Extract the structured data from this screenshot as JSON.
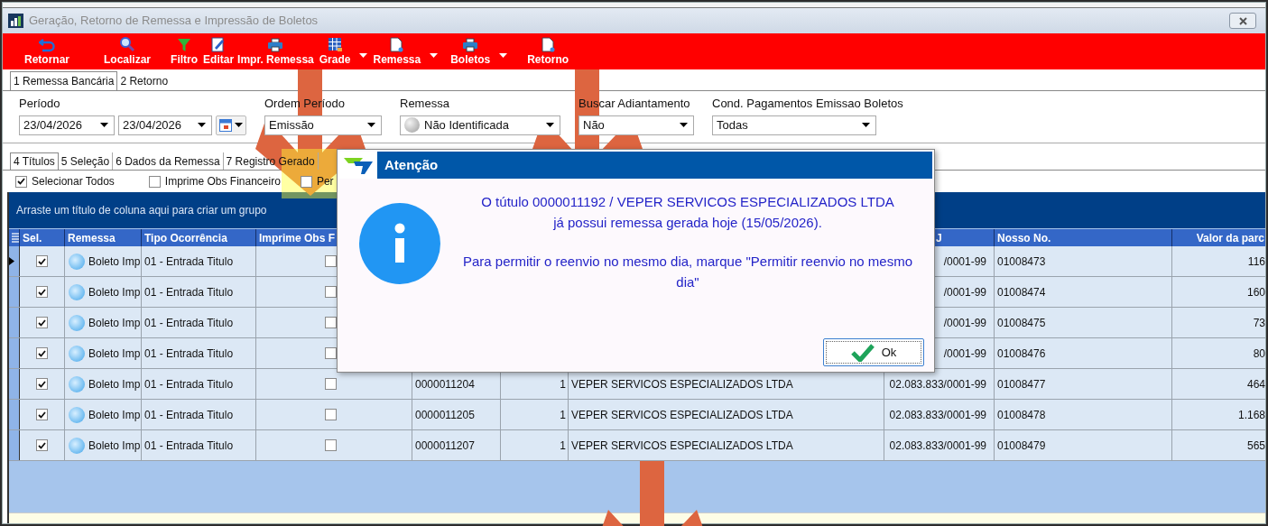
{
  "window": {
    "title": "Geração, Retorno de Remessa e Impressão de Boletos"
  },
  "toolbar": [
    {
      "label": "Retornar",
      "kind": "undo",
      "dropdown": false
    },
    {
      "label": "Localizar",
      "kind": "search",
      "dropdown": false
    },
    {
      "label": "Filtro",
      "kind": "filter",
      "dropdown": false
    },
    {
      "label": "Editar",
      "kind": "edit",
      "dropdown": false
    },
    {
      "label": "Impr. Remessa",
      "kind": "print",
      "dropdown": false
    },
    {
      "label": "Grade",
      "kind": "grid",
      "dropdown": true
    },
    {
      "label": "Remessa",
      "kind": "doc",
      "dropdown": true
    },
    {
      "label": "Boletos",
      "kind": "print",
      "dropdown": true
    },
    {
      "label": "Retorno",
      "kind": "doc",
      "dropdown": false
    }
  ],
  "main_tabs": [
    {
      "label": "1 Remessa Bancária",
      "selected": true
    },
    {
      "label": "2 Retorno",
      "selected": false
    }
  ],
  "filters": {
    "periodo": {
      "label": "Período",
      "from": "23/04/2026",
      "to": "23/04/2026"
    },
    "ordem": {
      "label": "Ordem Período",
      "value": "Emissão"
    },
    "remessa": {
      "label": "Remessa",
      "value": "Não Identificada"
    },
    "adiantamento": {
      "label": "Buscar Adiantamento",
      "value": "Não"
    },
    "cond": {
      "label": "Cond. Pagamentos Emissao Boletos",
      "value": "Todas"
    }
  },
  "sub_tabs": [
    {
      "label": "4 Títulos",
      "selected": true
    },
    {
      "label": "5 Seleção",
      "selected": false
    },
    {
      "label": "6 Dados da Remessa",
      "selected": false
    },
    {
      "label": "7 Registro Gerado",
      "selected": false
    }
  ],
  "options": [
    {
      "label": "Selecionar Todos",
      "checked": true
    },
    {
      "label": "Imprime Obs Financeiro",
      "checked": false
    },
    {
      "label": "Per",
      "checked": false
    }
  ],
  "grid": {
    "group_hint": "Arraste um título de coluna aqui para criar um grupo",
    "columns": [
      {
        "label": "Sel."
      },
      {
        "label": "Remessa"
      },
      {
        "label": "Tipo Ocorrência"
      },
      {
        "label": "Imprime Obs F"
      },
      {
        "label": "J"
      },
      {
        "label": "Nosso No."
      },
      {
        "label": "Valor da parc"
      }
    ],
    "rows": [
      {
        "current": true,
        "sel": true,
        "remessa": "Boleto Imp",
        "tipo": "01 - Entrada Titulo",
        "imprime_obs": false,
        "cnpj": "/0001-99",
        "nosso": "01008473",
        "valor": "116"
      },
      {
        "current": false,
        "sel": true,
        "remessa": "Boleto Imp",
        "tipo": "01 - Entrada Titulo",
        "imprime_obs": false,
        "cnpj": "/0001-99",
        "nosso": "01008474",
        "valor": "160"
      },
      {
        "current": false,
        "sel": true,
        "remessa": "Boleto Imp",
        "tipo": "01 - Entrada Titulo",
        "imprime_obs": false,
        "cnpj": "/0001-99",
        "nosso": "01008475",
        "valor": "73"
      },
      {
        "current": false,
        "sel": true,
        "remessa": "Boleto Imp",
        "tipo": "01 - Entrada Titulo",
        "imprime_obs": false,
        "cnpj": "/0001-99",
        "nosso": "01008476",
        "valor": "80"
      },
      {
        "current": false,
        "sel": true,
        "remessa": "Boleto Imp",
        "tipo": "01 - Entrada Titulo",
        "imprime_obs": false,
        "titulo": "0000011204",
        "parcela": "1",
        "nome": "VEPER SERVICOS ESPECIALIZADOS LTDA",
        "cnpj": "02.083.833/0001-99",
        "nosso": "01008477",
        "valor": "464"
      },
      {
        "current": false,
        "sel": true,
        "remessa": "Boleto Imp",
        "tipo": "01 - Entrada Titulo",
        "imprime_obs": false,
        "titulo": "0000011205",
        "parcela": "1",
        "nome": "VEPER SERVICOS ESPECIALIZADOS LTDA",
        "cnpj": "02.083.833/0001-99",
        "nosso": "01008478",
        "valor": "1.168"
      },
      {
        "current": false,
        "sel": true,
        "remessa": "Boleto Imp",
        "tipo": "01 - Entrada Titulo",
        "imprime_obs": false,
        "titulo": "0000011207",
        "parcela": "1",
        "nome": "VEPER SERVICOS ESPECIALIZADOS LTDA",
        "cnpj": "02.083.833/0001-99",
        "nosso": "01008479",
        "valor": "565"
      }
    ]
  },
  "dialog": {
    "title": "Atenção",
    "message": [
      "O tútulo 0000011192 / VEPER SERVICOS ESPECIALIZADOS LTDA\njá possui remessa gerada hoje (15/05/2026).",
      "Para permitir o reenvio no mesmo dia, marque \"Permitir reenvio no mesmo dia\""
    ],
    "button": "Ok"
  }
}
